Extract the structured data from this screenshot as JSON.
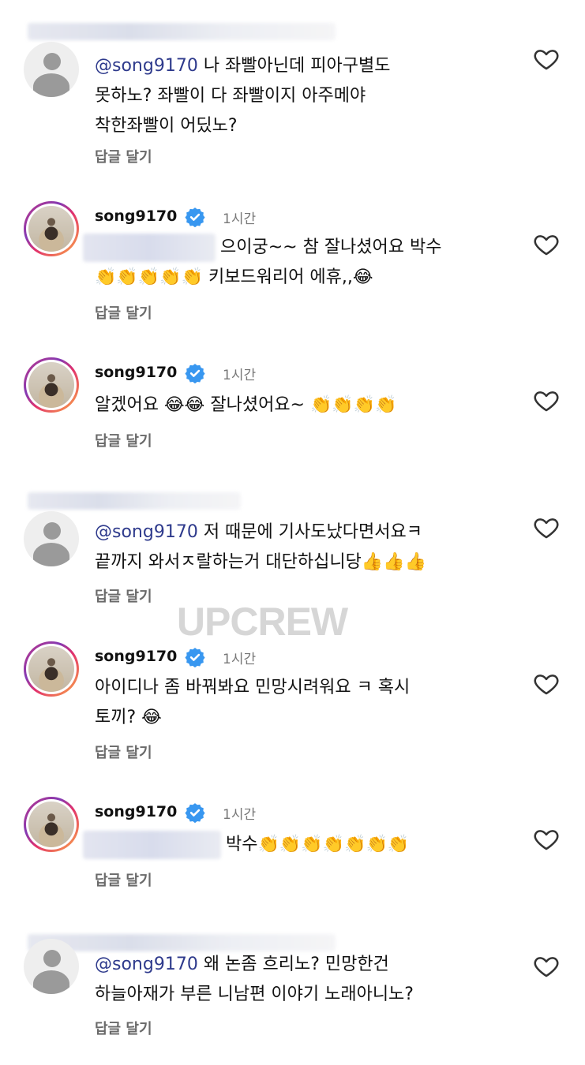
{
  "watermark": "UPCREW",
  "reply_label": "답글 달기",
  "comments": [
    {
      "kind": "anon",
      "mention": "@song9170",
      "lines": [
        " 나 좌빨아닌데 피아구별도",
        "못하노? 좌빨이 다 좌빨이지 아주메야",
        "착한좌빨이 어딨노?"
      ]
    },
    {
      "kind": "owner",
      "username": "song9170",
      "time": "1시간",
      "lines": [
        "으이궁~~ 참 잘나셨어요 박수",
        "👏👏👏👏👏 키보드워리어 에휴,,😂"
      ]
    },
    {
      "kind": "owner",
      "username": "song9170",
      "time": "1시간",
      "lines": [
        "알겠어요 😂😂 잘나셨어요~ 👏👏👏👏"
      ]
    },
    {
      "kind": "anon",
      "mention": "@song9170",
      "lines": [
        " 저 때문에 기사도났다면서요ㅋ",
        "끝까지 와서ㅈ랄하는거 대단하십니당👍👍👍"
      ]
    },
    {
      "kind": "owner",
      "username": "song9170",
      "time": "1시간",
      "lines": [
        "아이디나 좀 바꿔봐요 민망시려워요  ㅋ 혹시",
        "토끼? 😂"
      ]
    },
    {
      "kind": "owner",
      "username": "song9170",
      "time": "1시간",
      "lines": [
        "박수👏👏👏👏👏👏👏"
      ]
    },
    {
      "kind": "anon",
      "mention": "@song9170",
      "lines": [
        " 왜 논좀 흐리노? 민망한건",
        "하늘아재가 부른 니남편 이야기 노래아니노?"
      ]
    }
  ],
  "icons": {
    "heart": "heart-icon",
    "verified": "verified-badge-icon",
    "avatar": "avatar"
  },
  "colors": {
    "mention": "#2e3a8c",
    "verified": "#3897f0",
    "meta": "#777777"
  }
}
